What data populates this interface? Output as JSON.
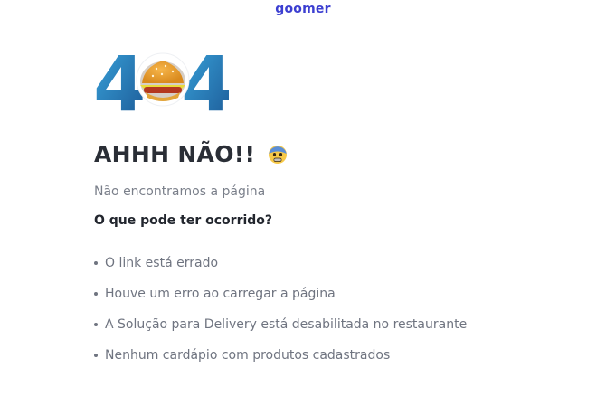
{
  "header": {
    "brand": "goomer"
  },
  "error": {
    "code_left": "4",
    "code_right": "4",
    "center_icon": "burger-icon",
    "title": "AHHH NÃO!!",
    "title_emoji": "scared-face-emoji",
    "subtitle": "Não encontramos a página",
    "question": "O que pode ter ocorrido?",
    "reasons": [
      "O link está errado",
      "Houve um erro ao carregar a página",
      "A Solução para Delivery está desabilitada no restaurante",
      "Nenhum cardápio com produtos cadastrados"
    ]
  },
  "colors": {
    "brand": "#3c3fd1",
    "digit_light": "#39a0d8",
    "digit_dark": "#1d5a94",
    "text_dark": "#2a2e36",
    "text_muted": "#6f7480"
  }
}
